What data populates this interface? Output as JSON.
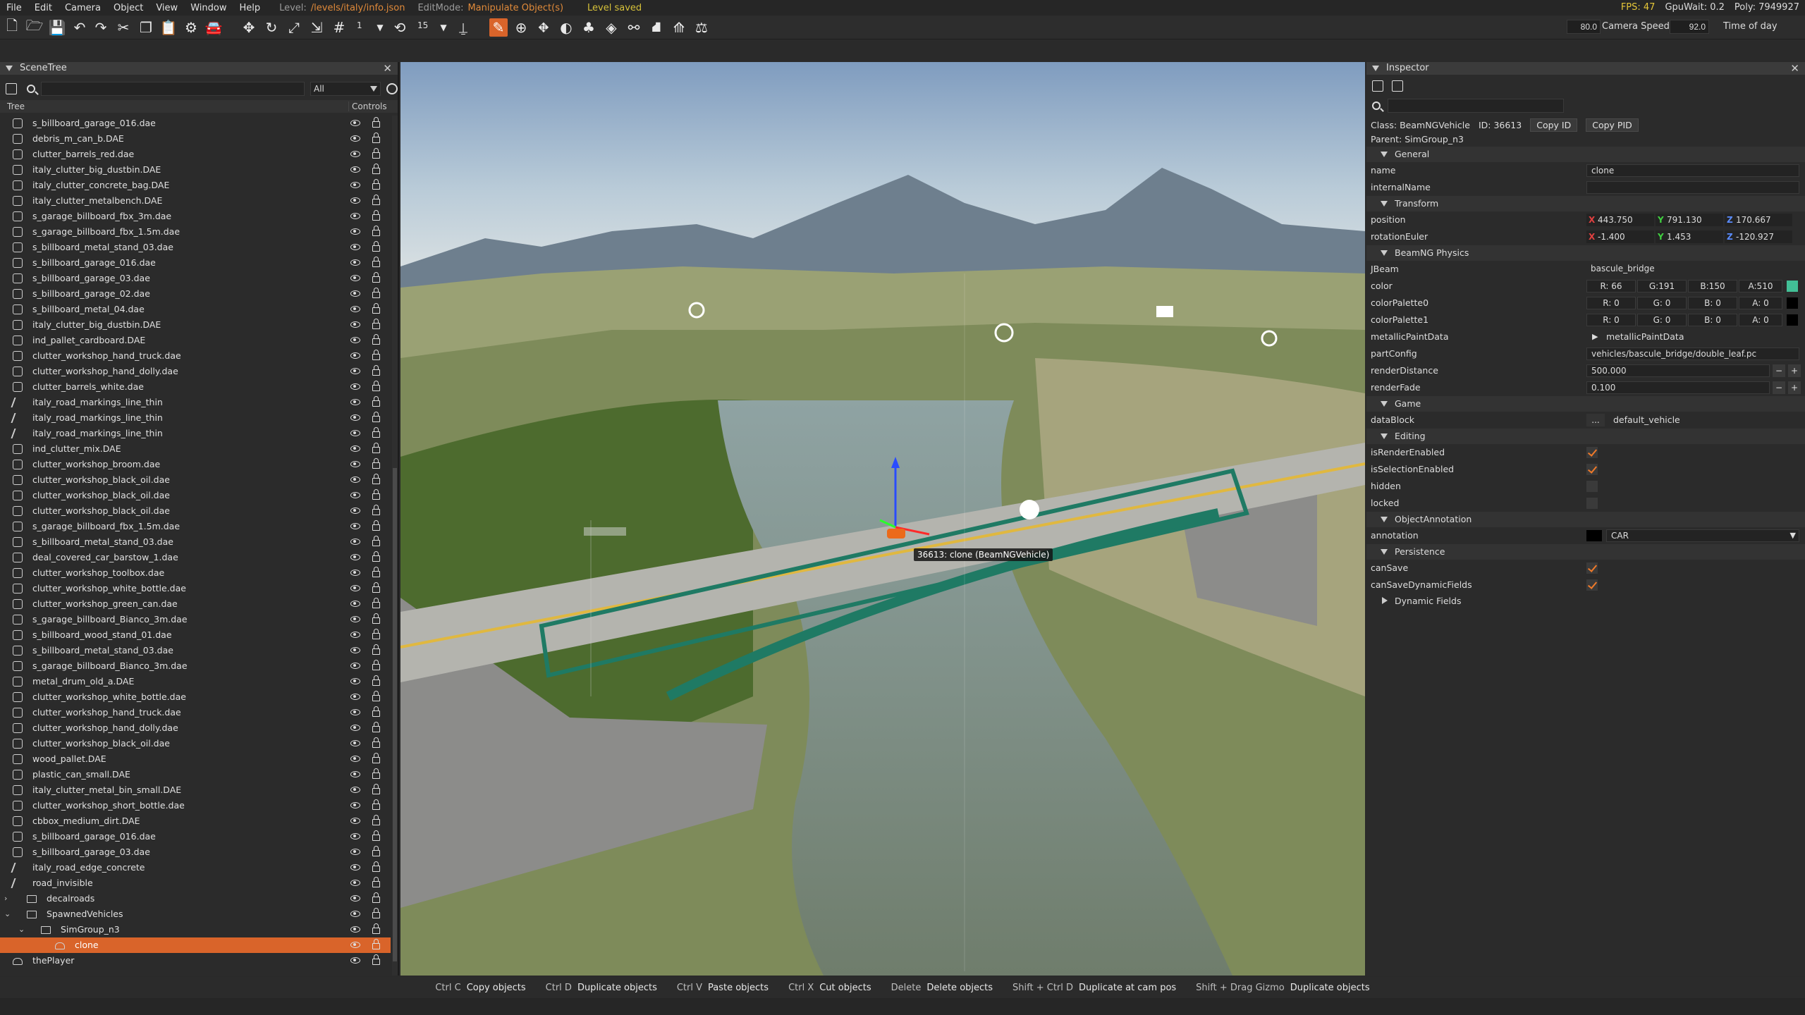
{
  "menubar": {
    "items": [
      "File",
      "Edit",
      "Camera",
      "Object",
      "View",
      "Window",
      "Help"
    ],
    "level_label": "Level:",
    "level_value": "/levels/italy/info.json",
    "editmode_label": "EditMode:",
    "editmode_value": "Manipulate Object(s)",
    "status": "Level saved",
    "fps": "FPS: 47",
    "gpuwait": "GpuWait: 0.2",
    "poly": "Poly: 7949927"
  },
  "toolbar": {
    "snap_value": "1",
    "rot_snap_value": "15",
    "speed_field_value": "80.0",
    "camera_speed_label": "Camera Speed",
    "time_field_value": "92.0",
    "time_label": "Time of day"
  },
  "scenetree": {
    "title": "SceneTree",
    "filter": "All",
    "col_tree": "Tree",
    "col_controls": "Controls",
    "rows": [
      {
        "name": "s_billboard_garage_016.dae",
        "type": "mesh"
      },
      {
        "name": "debris_m_can_b.DAE",
        "type": "mesh"
      },
      {
        "name": "clutter_barrels_red.dae",
        "type": "mesh"
      },
      {
        "name": "italy_clutter_big_dustbin.DAE",
        "type": "mesh"
      },
      {
        "name": "italy_clutter_concrete_bag.DAE",
        "type": "mesh"
      },
      {
        "name": "italy_clutter_metalbench.DAE",
        "type": "mesh"
      },
      {
        "name": "s_garage_billboard_fbx_3m.dae",
        "type": "mesh"
      },
      {
        "name": "s_garage_billboard_fbx_1.5m.dae",
        "type": "mesh"
      },
      {
        "name": "s_billboard_metal_stand_03.dae",
        "type": "mesh"
      },
      {
        "name": "s_billboard_garage_016.dae",
        "type": "mesh"
      },
      {
        "name": "s_billboard_garage_03.dae",
        "type": "mesh"
      },
      {
        "name": "s_billboard_garage_02.dae",
        "type": "mesh"
      },
      {
        "name": "s_billboard_metal_04.dae",
        "type": "mesh"
      },
      {
        "name": "italy_clutter_big_dustbin.DAE",
        "type": "mesh"
      },
      {
        "name": "ind_pallet_cardboard.DAE",
        "type": "mesh"
      },
      {
        "name": "clutter_workshop_hand_truck.dae",
        "type": "mesh"
      },
      {
        "name": "clutter_workshop_hand_dolly.dae",
        "type": "mesh"
      },
      {
        "name": "clutter_barrels_white.dae",
        "type": "mesh"
      },
      {
        "name": "italy_road_markings_line_thin",
        "type": "road"
      },
      {
        "name": "italy_road_markings_line_thin",
        "type": "road"
      },
      {
        "name": "italy_road_markings_line_thin",
        "type": "road"
      },
      {
        "name": "ind_clutter_mix.DAE",
        "type": "mesh"
      },
      {
        "name": "clutter_workshop_broom.dae",
        "type": "mesh"
      },
      {
        "name": "clutter_workshop_black_oil.dae",
        "type": "mesh"
      },
      {
        "name": "clutter_workshop_black_oil.dae",
        "type": "mesh"
      },
      {
        "name": "clutter_workshop_black_oil.dae",
        "type": "mesh"
      },
      {
        "name": "s_garage_billboard_fbx_1.5m.dae",
        "type": "mesh"
      },
      {
        "name": "s_billboard_metal_stand_03.dae",
        "type": "mesh"
      },
      {
        "name": "deal_covered_car_barstow_1.dae",
        "type": "mesh"
      },
      {
        "name": "clutter_workshop_toolbox.dae",
        "type": "mesh"
      },
      {
        "name": "clutter_workshop_white_bottle.dae",
        "type": "mesh"
      },
      {
        "name": "clutter_workshop_green_can.dae",
        "type": "mesh"
      },
      {
        "name": "s_garage_billboard_Bianco_3m.dae",
        "type": "mesh"
      },
      {
        "name": "s_billboard_wood_stand_01.dae",
        "type": "mesh"
      },
      {
        "name": "s_billboard_metal_stand_03.dae",
        "type": "mesh"
      },
      {
        "name": "s_garage_billboard_Bianco_3m.dae",
        "type": "mesh"
      },
      {
        "name": "metal_drum_old_a.DAE",
        "type": "mesh"
      },
      {
        "name": "clutter_workshop_white_bottle.dae",
        "type": "mesh"
      },
      {
        "name": "clutter_workshop_hand_truck.dae",
        "type": "mesh"
      },
      {
        "name": "clutter_workshop_hand_dolly.dae",
        "type": "mesh"
      },
      {
        "name": "clutter_workshop_black_oil.dae",
        "type": "mesh"
      },
      {
        "name": "wood_pallet.DAE",
        "type": "mesh"
      },
      {
        "name": "plastic_can_small.DAE",
        "type": "mesh"
      },
      {
        "name": "italy_clutter_metal_bin_small.DAE",
        "type": "mesh"
      },
      {
        "name": "clutter_workshop_short_bottle.dae",
        "type": "mesh"
      },
      {
        "name": "cbbox_medium_dirt.DAE",
        "type": "mesh"
      },
      {
        "name": "s_billboard_garage_016.dae",
        "type": "mesh"
      },
      {
        "name": "s_billboard_garage_03.dae",
        "type": "mesh"
      },
      {
        "name": "italy_road_edge_concrete",
        "type": "road"
      },
      {
        "name": "road_invisible",
        "type": "road"
      },
      {
        "name": "decalroads",
        "type": "folder",
        "expander": "›",
        "indent": 0
      },
      {
        "name": "SpawnedVehicles",
        "type": "folder",
        "expander": "⌄",
        "indent": 0
      },
      {
        "name": "SimGroup_n3",
        "type": "folder",
        "expander": "⌄",
        "indent": 1
      },
      {
        "name": "clone",
        "type": "car",
        "indent": 2,
        "selected": true
      },
      {
        "name": "thePlayer",
        "type": "car",
        "indent": 0
      }
    ]
  },
  "viewport": {
    "selection_label": "36613: clone (BeamNGVehicle)"
  },
  "inspector": {
    "title": "Inspector",
    "class_label": "Class:",
    "class_value": "BeamNGVehicle",
    "id_label": "ID:",
    "id_value": "36613",
    "copy_id": "Copy ID",
    "copy_pid": "Copy PID",
    "parent_label": "Parent:",
    "parent_value": "SimGroup_n3",
    "sections": {
      "general": "General",
      "transform": "Transform",
      "physics": "BeamNG Physics",
      "game": "Game",
      "editing": "Editing",
      "annotation": "ObjectAnnotation",
      "persistence": "Persistence",
      "dynamic": "Dynamic Fields"
    },
    "props": {
      "name_label": "name",
      "name_value": "clone",
      "internalName_label": "internalName",
      "internalName_value": "",
      "position_label": "position",
      "pos_x": "443.750",
      "pos_y": "791.130",
      "pos_z": "170.667",
      "rotation_label": "rotationEuler",
      "rot_x": "-1.400",
      "rot_y": "1.453",
      "rot_z": "-120.927",
      "jbeam_label": "JBeam",
      "jbeam_value": "bascule_bridge",
      "color_label": "color",
      "color_r": "R: 66",
      "color_g": "G:191",
      "color_b": "B:150",
      "color_a": "A:510",
      "cp0_label": "colorPalette0",
      "cp0_r": "R: 0",
      "cp0_g": "G: 0",
      "cp0_b": "B: 0",
      "cp0_a": "A: 0",
      "cp1_label": "colorPalette1",
      "cp1_r": "R: 0",
      "cp1_g": "G: 0",
      "cp1_b": "B: 0",
      "cp1_a": "A: 0",
      "metallic_label": "metallicPaintData",
      "metallic_value": "metallicPaintData",
      "partconfig_label": "partConfig",
      "partconfig_value": "vehicles/bascule_bridge/double_leaf.pc",
      "renderdist_label": "renderDistance",
      "renderdist_value": "500.000",
      "renderfade_label": "renderFade",
      "renderfade_value": "0.100",
      "datablock_label": "dataBlock",
      "datablock_btn": "...",
      "datablock_value": "default_vehicle",
      "isRenderEnabled_label": "isRenderEnabled",
      "isSelectionEnabled_label": "isSelectionEnabled",
      "hidden_label": "hidden",
      "locked_label": "locked",
      "annotation_label": "annotation",
      "annotation_value": "CAR",
      "canSave_label": "canSave",
      "canSaveDynamic_label": "canSaveDynamicFields"
    },
    "colors": {
      "color_swatch": "#42bf96",
      "palette_swatch": "#000000",
      "check": "#f07a2a"
    }
  },
  "statusbar": [
    {
      "key": "Ctrl C",
      "desc": "Copy objects"
    },
    {
      "key": "Ctrl D",
      "desc": "Duplicate objects"
    },
    {
      "key": "Ctrl V",
      "desc": "Paste objects"
    },
    {
      "key": "Ctrl X",
      "desc": "Cut objects"
    },
    {
      "key": "Delete",
      "desc": "Delete objects"
    },
    {
      "key": "Shift + Ctrl D",
      "desc": "Duplicate at cam pos"
    },
    {
      "key": "Shift + Drag Gizmo",
      "desc": "Duplicate objects"
    }
  ]
}
